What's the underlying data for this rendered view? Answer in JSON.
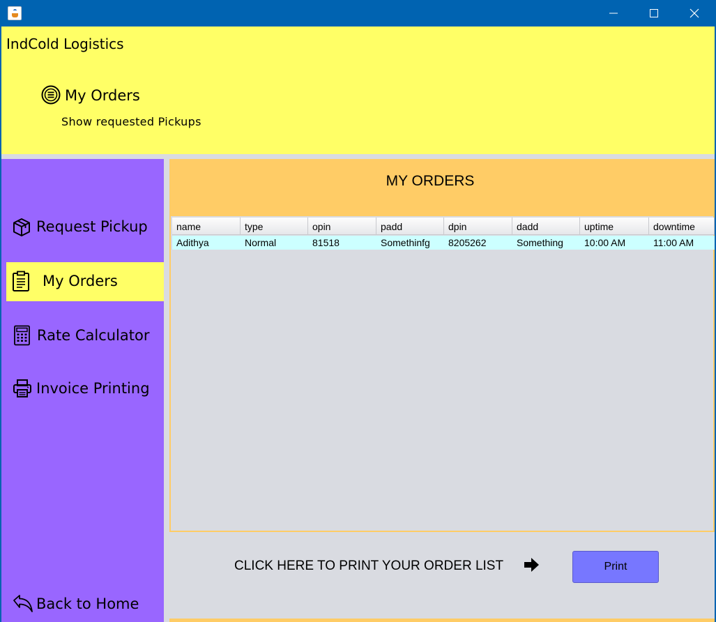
{
  "window": {
    "title": "",
    "controls": {
      "minimize_icon": "minimize-icon",
      "maximize_icon": "maximize-icon",
      "close_icon": "close-icon"
    }
  },
  "header": {
    "app_name": "IndCold Logistics",
    "section_title": "My Orders",
    "section_subtitle": "Show requested Pickups",
    "section_icon": "list-circle-icon",
    "background": "#ffff66"
  },
  "sidebar": {
    "background": "#9966ff",
    "active_background": "#ffff66",
    "items": [
      {
        "label": "Request Pickup",
        "icon": "package-icon",
        "active": false
      },
      {
        "label": "My Orders",
        "icon": "clipboard-icon",
        "active": true
      },
      {
        "label": "Rate Calculator",
        "icon": "calculator-icon",
        "active": false
      },
      {
        "label": "Invoice Printing",
        "icon": "printer-icon",
        "active": false
      }
    ],
    "back": {
      "label": "Back to Home",
      "icon": "back-arrow-icon"
    }
  },
  "main": {
    "title": "MY ORDERS",
    "accent": "#ffcc66",
    "table": {
      "columns": [
        "name",
        "type",
        "opin",
        "padd",
        "dpin",
        "dadd",
        "uptime",
        "downtime"
      ],
      "rows": [
        [
          "Adithya",
          "Normal",
          "81518",
          "Somethinfg",
          "8205262",
          "Something",
          "10:00 AM",
          "11:00 AM"
        ]
      ],
      "row_highlight": "#ccffff"
    },
    "print_hint": "CLICK HERE TO PRINT YOUR ORDER LIST",
    "print_hint_icon": "right-arrow-icon",
    "print_button": {
      "label": "Print",
      "color": "#7777ff"
    }
  }
}
